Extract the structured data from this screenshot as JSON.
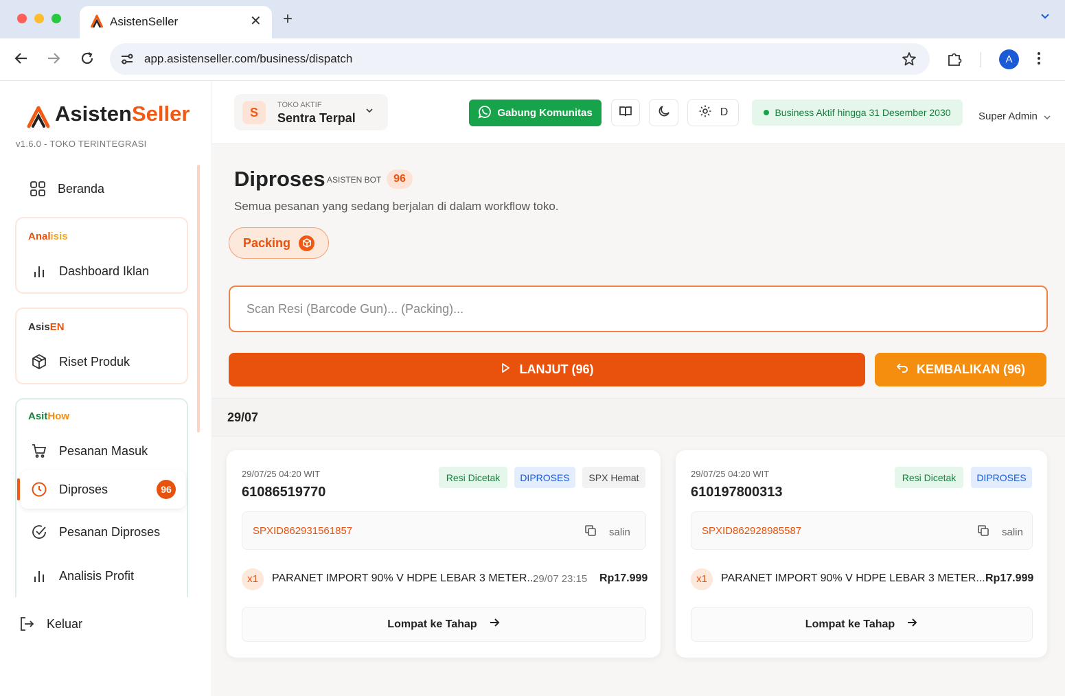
{
  "browser": {
    "tab_title": "AsistenSeller",
    "url": "app.asistenseller.com/business/dispatch",
    "profile_initial": "A"
  },
  "sidebar": {
    "logo_part1": "Asisten",
    "logo_part2": "Seller",
    "version": "v1.6.0 - TOKO TERINTEGRASI",
    "home": "Beranda",
    "groups": [
      {
        "label_a": "Anal",
        "label_b": "isis",
        "items": [
          "Dashboard Iklan"
        ]
      },
      {
        "label_a": "Asis",
        "label_b": "EN",
        "items": [
          "Riset Produk"
        ]
      },
      {
        "label_a": "Asit",
        "label_b": "How",
        "items": [
          "Pesanan Masuk",
          "Diproses",
          "Pesanan Diproses",
          "Analisis Profit"
        ]
      }
    ],
    "active_badge": "96",
    "logout": "Keluar"
  },
  "header": {
    "store_initial": "S",
    "store_label": "TOKO AKTIF",
    "store_name": "Sentra Terpal",
    "community_btn": "Gabung Komunitas",
    "settings_letter": "D",
    "business_status": "Business Aktif hingga 31 Desember 2030",
    "user": "Super Admin"
  },
  "page": {
    "title": "Diproses",
    "bot_label": "ASISTEN BOT",
    "count": "96",
    "subtitle": "Semua pesanan yang sedang berjalan di dalam workflow toko.",
    "stage_chip": "Packing",
    "scan_placeholder": "Scan Resi (Barcode Gun)... (Packing)...",
    "next_btn": "LANJUT (96)",
    "back_btn": "KEMBALIKAN (96)",
    "date_group": "29/07"
  },
  "orders": [
    {
      "time": "29/07/25 04:20 WIT",
      "order_id": "61086519770",
      "tags": [
        "Resi Dicetak",
        "DIPROSES",
        "SPX Hemat"
      ],
      "resi": "SPXID862931561857",
      "copy_label": "salin",
      "qty": "x1",
      "product": "PARANET IMPORT 90% V HDPE LEBAR 3 METER...",
      "item_date": "29/07 23:15",
      "price": "Rp17.999",
      "jump_label": "Lompat ke Tahap"
    },
    {
      "time": "29/07/25 04:20 WIT",
      "order_id": "610197800313",
      "tags": [
        "Resi Dicetak",
        "DIPROSES"
      ],
      "resi": "SPXID862928985587",
      "copy_label": "salin",
      "qty": "x1",
      "product": "PARANET IMPORT 90% V HDPE LEBAR 3 METER...",
      "price": "Rp17.999",
      "jump_label": "Lompat ke Tahap"
    }
  ],
  "colors": {
    "accent": "#e9520c",
    "accent_secondary": "#f58d0e",
    "whatsapp_green": "#16a34a",
    "status_green_bg": "#e5f6ea",
    "status_blue_bg": "#e3edfd"
  }
}
